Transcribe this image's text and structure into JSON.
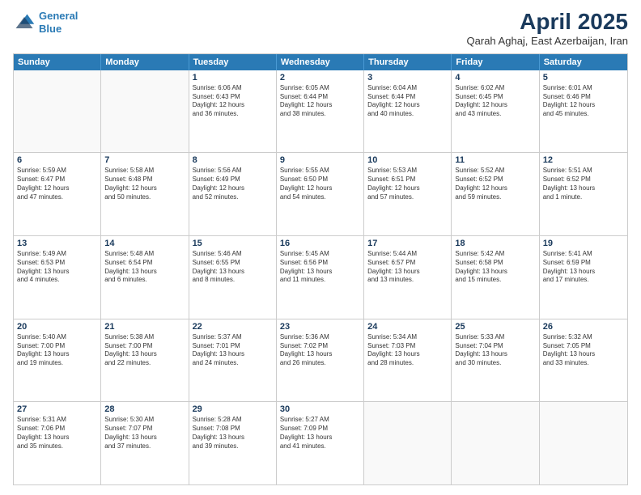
{
  "header": {
    "logo_line1": "General",
    "logo_line2": "Blue",
    "month": "April 2025",
    "location": "Qarah Aghaj, East Azerbaijan, Iran"
  },
  "weekdays": [
    "Sunday",
    "Monday",
    "Tuesday",
    "Wednesday",
    "Thursday",
    "Friday",
    "Saturday"
  ],
  "rows": [
    [
      {
        "day": "",
        "lines": []
      },
      {
        "day": "",
        "lines": []
      },
      {
        "day": "1",
        "lines": [
          "Sunrise: 6:06 AM",
          "Sunset: 6:43 PM",
          "Daylight: 12 hours",
          "and 36 minutes."
        ]
      },
      {
        "day": "2",
        "lines": [
          "Sunrise: 6:05 AM",
          "Sunset: 6:44 PM",
          "Daylight: 12 hours",
          "and 38 minutes."
        ]
      },
      {
        "day": "3",
        "lines": [
          "Sunrise: 6:04 AM",
          "Sunset: 6:44 PM",
          "Daylight: 12 hours",
          "and 40 minutes."
        ]
      },
      {
        "day": "4",
        "lines": [
          "Sunrise: 6:02 AM",
          "Sunset: 6:45 PM",
          "Daylight: 12 hours",
          "and 43 minutes."
        ]
      },
      {
        "day": "5",
        "lines": [
          "Sunrise: 6:01 AM",
          "Sunset: 6:46 PM",
          "Daylight: 12 hours",
          "and 45 minutes."
        ]
      }
    ],
    [
      {
        "day": "6",
        "lines": [
          "Sunrise: 5:59 AM",
          "Sunset: 6:47 PM",
          "Daylight: 12 hours",
          "and 47 minutes."
        ]
      },
      {
        "day": "7",
        "lines": [
          "Sunrise: 5:58 AM",
          "Sunset: 6:48 PM",
          "Daylight: 12 hours",
          "and 50 minutes."
        ]
      },
      {
        "day": "8",
        "lines": [
          "Sunrise: 5:56 AM",
          "Sunset: 6:49 PM",
          "Daylight: 12 hours",
          "and 52 minutes."
        ]
      },
      {
        "day": "9",
        "lines": [
          "Sunrise: 5:55 AM",
          "Sunset: 6:50 PM",
          "Daylight: 12 hours",
          "and 54 minutes."
        ]
      },
      {
        "day": "10",
        "lines": [
          "Sunrise: 5:53 AM",
          "Sunset: 6:51 PM",
          "Daylight: 12 hours",
          "and 57 minutes."
        ]
      },
      {
        "day": "11",
        "lines": [
          "Sunrise: 5:52 AM",
          "Sunset: 6:52 PM",
          "Daylight: 12 hours",
          "and 59 minutes."
        ]
      },
      {
        "day": "12",
        "lines": [
          "Sunrise: 5:51 AM",
          "Sunset: 6:52 PM",
          "Daylight: 13 hours",
          "and 1 minute."
        ]
      }
    ],
    [
      {
        "day": "13",
        "lines": [
          "Sunrise: 5:49 AM",
          "Sunset: 6:53 PM",
          "Daylight: 13 hours",
          "and 4 minutes."
        ]
      },
      {
        "day": "14",
        "lines": [
          "Sunrise: 5:48 AM",
          "Sunset: 6:54 PM",
          "Daylight: 13 hours",
          "and 6 minutes."
        ]
      },
      {
        "day": "15",
        "lines": [
          "Sunrise: 5:46 AM",
          "Sunset: 6:55 PM",
          "Daylight: 13 hours",
          "and 8 minutes."
        ]
      },
      {
        "day": "16",
        "lines": [
          "Sunrise: 5:45 AM",
          "Sunset: 6:56 PM",
          "Daylight: 13 hours",
          "and 11 minutes."
        ]
      },
      {
        "day": "17",
        "lines": [
          "Sunrise: 5:44 AM",
          "Sunset: 6:57 PM",
          "Daylight: 13 hours",
          "and 13 minutes."
        ]
      },
      {
        "day": "18",
        "lines": [
          "Sunrise: 5:42 AM",
          "Sunset: 6:58 PM",
          "Daylight: 13 hours",
          "and 15 minutes."
        ]
      },
      {
        "day": "19",
        "lines": [
          "Sunrise: 5:41 AM",
          "Sunset: 6:59 PM",
          "Daylight: 13 hours",
          "and 17 minutes."
        ]
      }
    ],
    [
      {
        "day": "20",
        "lines": [
          "Sunrise: 5:40 AM",
          "Sunset: 7:00 PM",
          "Daylight: 13 hours",
          "and 19 minutes."
        ]
      },
      {
        "day": "21",
        "lines": [
          "Sunrise: 5:38 AM",
          "Sunset: 7:00 PM",
          "Daylight: 13 hours",
          "and 22 minutes."
        ]
      },
      {
        "day": "22",
        "lines": [
          "Sunrise: 5:37 AM",
          "Sunset: 7:01 PM",
          "Daylight: 13 hours",
          "and 24 minutes."
        ]
      },
      {
        "day": "23",
        "lines": [
          "Sunrise: 5:36 AM",
          "Sunset: 7:02 PM",
          "Daylight: 13 hours",
          "and 26 minutes."
        ]
      },
      {
        "day": "24",
        "lines": [
          "Sunrise: 5:34 AM",
          "Sunset: 7:03 PM",
          "Daylight: 13 hours",
          "and 28 minutes."
        ]
      },
      {
        "day": "25",
        "lines": [
          "Sunrise: 5:33 AM",
          "Sunset: 7:04 PM",
          "Daylight: 13 hours",
          "and 30 minutes."
        ]
      },
      {
        "day": "26",
        "lines": [
          "Sunrise: 5:32 AM",
          "Sunset: 7:05 PM",
          "Daylight: 13 hours",
          "and 33 minutes."
        ]
      }
    ],
    [
      {
        "day": "27",
        "lines": [
          "Sunrise: 5:31 AM",
          "Sunset: 7:06 PM",
          "Daylight: 13 hours",
          "and 35 minutes."
        ]
      },
      {
        "day": "28",
        "lines": [
          "Sunrise: 5:30 AM",
          "Sunset: 7:07 PM",
          "Daylight: 13 hours",
          "and 37 minutes."
        ]
      },
      {
        "day": "29",
        "lines": [
          "Sunrise: 5:28 AM",
          "Sunset: 7:08 PM",
          "Daylight: 13 hours",
          "and 39 minutes."
        ]
      },
      {
        "day": "30",
        "lines": [
          "Sunrise: 5:27 AM",
          "Sunset: 7:09 PM",
          "Daylight: 13 hours",
          "and 41 minutes."
        ]
      },
      {
        "day": "",
        "lines": []
      },
      {
        "day": "",
        "lines": []
      },
      {
        "day": "",
        "lines": []
      }
    ]
  ]
}
